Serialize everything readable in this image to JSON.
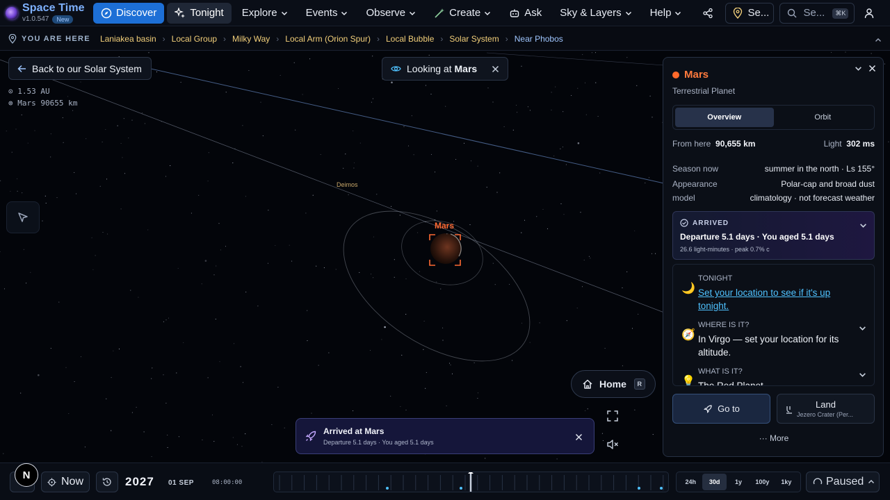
{
  "brand": {
    "title": "Space Time",
    "version": "v1.0.547",
    "badge": "New"
  },
  "nav": {
    "discover": "Discover",
    "tonight": "Tonight",
    "explore": "Explore",
    "events": "Events",
    "observe": "Observe",
    "create": "Create",
    "ask": "Ask",
    "sky_layers": "Sky & Layers",
    "help": "Help",
    "location": "Se...",
    "search_placeholder": "Se...",
    "search_shortcut": "⌘K"
  },
  "breadcrumb": {
    "heading": "YOU ARE HERE",
    "items": [
      "Laniakea basin",
      "Local Group",
      "Milky Way",
      "Local Arm (Orion Spur)",
      "Local Bubble",
      "Solar System",
      "Near Phobos"
    ]
  },
  "view": {
    "back_label": "Back to our Solar System",
    "distance_au": "1.53 AU",
    "distance_target": "Mars 90655 km",
    "looking_prefix": "Looking at",
    "looking_target": "Mars",
    "label_deimos": "Deimos",
    "label_mars": "Mars",
    "home_label": "Home",
    "home_key": "R"
  },
  "toast": {
    "title": "Arrived at Mars",
    "subtitle": "Departure 5.1 days · You aged 5.1 days"
  },
  "panel": {
    "name": "Mars",
    "type": "Terrestrial Planet",
    "tabs": [
      "Overview",
      "Orbit"
    ],
    "from_here_label": "From here",
    "from_here_value": "90,655 km",
    "light_label": "Light",
    "light_value": "302 ms",
    "season_label": "Season now",
    "season_value": "summer in the north · Ls 155°",
    "appearance_label": "Appearance",
    "appearance_value": "Polar-cap and broad dust",
    "model_label": "model",
    "model_value": "climatology · not forecast weather",
    "arrived": {
      "tag": "ARRIVED",
      "main": "Departure 5.1 days · You aged 5.1 days",
      "sub": "26.6 light-minutes · peak 0.7% c"
    },
    "facts": [
      {
        "tag": "TONIGHT",
        "body": "Set your location to see if it's up tonight."
      },
      {
        "tag": "WHERE IS IT?",
        "body": "In Virgo — set your location for its altitude."
      },
      {
        "tag": "WHAT IS IT?",
        "body": "The Red Planet."
      }
    ],
    "goto_label": "Go to",
    "land_label": "Land",
    "land_sub": "Jezero Crater (Per...",
    "more_label": "More"
  },
  "timeline": {
    "now_label": "Now",
    "year": "2027",
    "date": "01 SEP",
    "clock": "08:00:00",
    "ranges": [
      "24h",
      "30d",
      "1y",
      "100y",
      "1ky"
    ],
    "active_range": "30d",
    "state_label": "Paused",
    "n_badge": "N"
  },
  "colors": {
    "accent": "#1d6fd6",
    "mars": "#ff6a33",
    "link": "#4fc2ff",
    "crumb": "#f2cf7a"
  }
}
